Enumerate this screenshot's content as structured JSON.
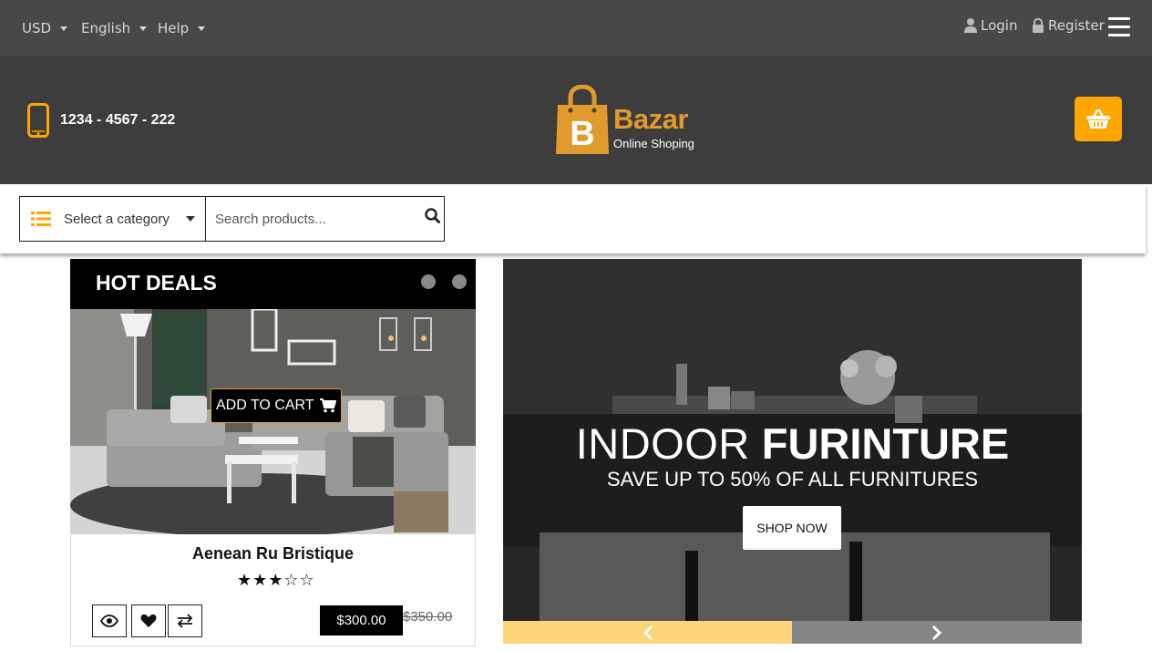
{
  "topbar": {
    "currency": "USD",
    "language": "English",
    "help": "Help",
    "login": "Login",
    "register": "Register"
  },
  "header": {
    "phone": "1234 - 4567 - 222",
    "logo_title": "Bazar",
    "logo_subtitle": "Online Shoping",
    "logo_letter": "B"
  },
  "search": {
    "category_label": "Select a category",
    "placeholder": "Search products..."
  },
  "hot_deals": {
    "title": "HOT DEALS",
    "add_to_cart": "ADD TO CART",
    "product_name": "Aenean Ru Bristique",
    "rating": 3,
    "rating_max": 5,
    "stars_display": "★★★☆☆",
    "price": "$300.00",
    "old_price": "$350.00"
  },
  "banner": {
    "title_light": "INDOOR",
    "title_bold": "FURINTURE",
    "subtitle": "SAVE UP TO 50% OF ALL FURNITURES",
    "button": "SHOP NOW"
  },
  "colors": {
    "accent": "#ffa500",
    "brand": "#e39a2c",
    "topbar": "#484848",
    "header": "#3d3d3d"
  }
}
